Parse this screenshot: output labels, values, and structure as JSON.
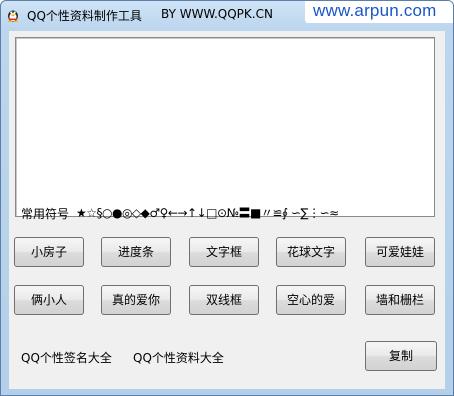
{
  "window": {
    "title": "QQ个性资料制作工具",
    "title_by": "BY WWW.QQPK.CN",
    "watermark": "www.arpun.com"
  },
  "editor": {
    "value": "",
    "symbols_label": "常用符号",
    "symbols": "★☆§○●◎◇◆♂♀←→↑↓□⊙№〓■〃≌∮ ∽∑⋮∽≈"
  },
  "buttons": {
    "row1": [
      "小房子",
      "进度条",
      "文字框",
      "花球文字",
      "可爱娃娃"
    ],
    "row2": [
      "俩小人",
      "真的爱你",
      "双线框",
      "空心的爱",
      "墙和栅栏"
    ]
  },
  "footer": {
    "link1": "QQ个性签名大全",
    "link2": "QQ个性资料大全",
    "copy_button": "复制"
  }
}
